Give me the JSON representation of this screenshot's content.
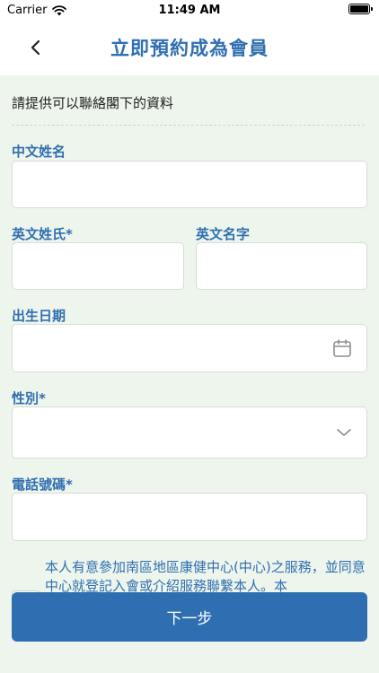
{
  "status_bar": {
    "carrier": "Carrier",
    "time": "11:49 AM"
  },
  "header": {
    "title": "立即預約成為會員"
  },
  "form": {
    "intro": "請提供可以聯絡閣下的資料",
    "chinese_name_label": "中文姓名",
    "chinese_name_value": "",
    "english_surname_label": "英文姓氏*",
    "english_surname_value": "",
    "english_given_name_label": "英文名字",
    "english_given_name_value": "",
    "dob_label": "出生日期",
    "dob_value": "",
    "gender_label": "性別*",
    "gender_value": "",
    "phone_label": "電話號碼*",
    "phone_value": ""
  },
  "consent": {
    "text": "本人有意參加南區地區康健中心(中心)之服務，並同意中心就登記入會或介紹服務聯繫本人。本"
  },
  "actions": {
    "next_label": "下一步"
  },
  "colors": {
    "accent": "#2f6fb1",
    "background": "#eef5ec"
  }
}
